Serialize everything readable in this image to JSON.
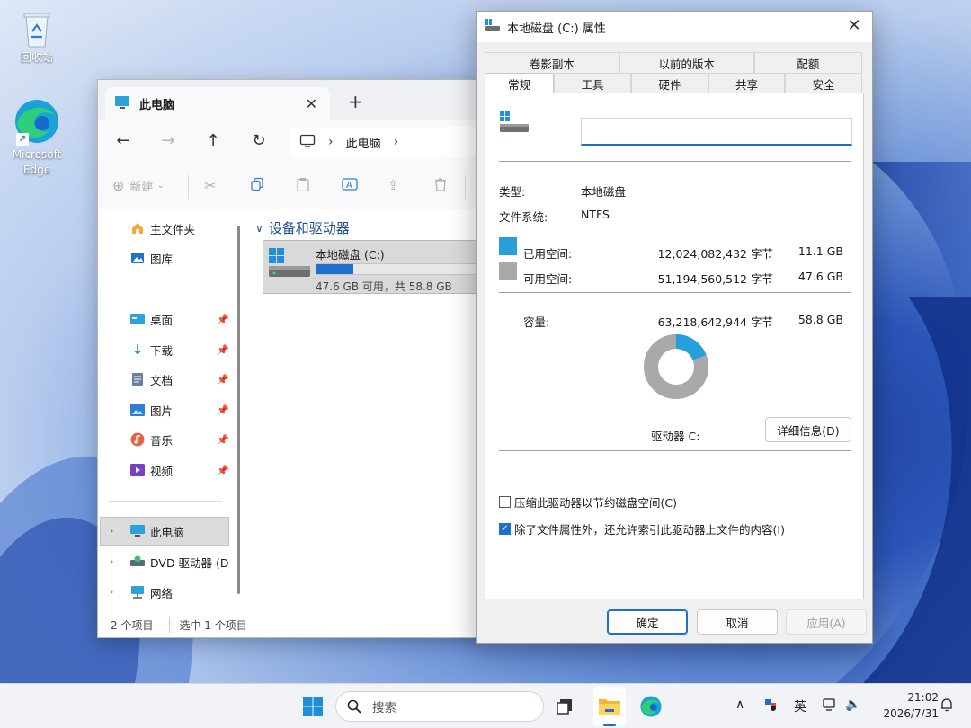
{
  "desktop": {
    "icons": [
      {
        "label": "回收站"
      },
      {
        "label": "Microsoft Edge"
      }
    ]
  },
  "explorer": {
    "tab_title": "此电脑",
    "new_tab": "+",
    "close_tab": "✕",
    "address": {
      "segments": [
        "此电脑"
      ]
    },
    "toolbar": {
      "new_label": "新建"
    },
    "sidebar": {
      "top_items": [
        {
          "label": "主文件夹",
          "icon": "home-icon"
        },
        {
          "label": "图库",
          "icon": "gallery-icon"
        }
      ],
      "pinned_items": [
        {
          "label": "桌面",
          "icon": "desktop-folder-icon"
        },
        {
          "label": "下载",
          "icon": "download-icon"
        },
        {
          "label": "文档",
          "icon": "document-icon"
        },
        {
          "label": "图片",
          "icon": "picture-icon"
        },
        {
          "label": "音乐",
          "icon": "music-icon"
        },
        {
          "label": "视频",
          "icon": "video-icon"
        }
      ],
      "tree_items": [
        {
          "label": "此电脑",
          "icon": "pc-icon"
        },
        {
          "label": "DVD 驱动器 (D",
          "icon": "dvd-icon"
        },
        {
          "label": "网络",
          "icon": "network-icon"
        }
      ]
    },
    "group_header": "设备和驱动器",
    "drive": {
      "name": "本地磁盘 (C:)",
      "used_fraction": 0.19,
      "free_text": "47.6 GB 可用，共 58.8 GB"
    },
    "status": {
      "count": "2 个项目",
      "selected": "选中 1 个项目"
    }
  },
  "properties": {
    "title": "本地磁盘 (C:) 属性",
    "tabs_top": [
      "卷影副本",
      "以前的版本",
      "配额"
    ],
    "tabs_bottom": [
      "常规",
      "工具",
      "硬件",
      "共享",
      "安全"
    ],
    "active_tab": "常规",
    "name_value": "",
    "type_label": "类型:",
    "type_value": "本地磁盘",
    "fs_label": "文件系统:",
    "fs_value": "NTFS",
    "used": {
      "label": "已用空间:",
      "bytes": "12,024,082,432 字节",
      "size": "11.1 GB",
      "color": "#26a0da"
    },
    "free": {
      "label": "可用空间:",
      "bytes": "51,194,560,512 字节",
      "size": "47.6 GB",
      "color": "#a9a9a9"
    },
    "capacity": {
      "label": "容量:",
      "bytes": "63,218,642,944 字节",
      "size": "58.8 GB"
    },
    "used_fraction": 0.19,
    "drive_label": "驱动器 C:",
    "details_button": "详细信息(D)",
    "compress_label": "压缩此驱动器以节约磁盘空间(C)",
    "compress_checked": false,
    "index_label": "除了文件属性外，还允许索引此驱动器上文件的内容(I)",
    "index_checked": true,
    "ok": "确定",
    "cancel": "取消",
    "apply": "应用(A)"
  },
  "taskbar": {
    "search_placeholder": "搜索",
    "tray": {
      "ime": "英"
    },
    "clock": {
      "time": "21:02",
      "date": "2026/7/31"
    }
  }
}
